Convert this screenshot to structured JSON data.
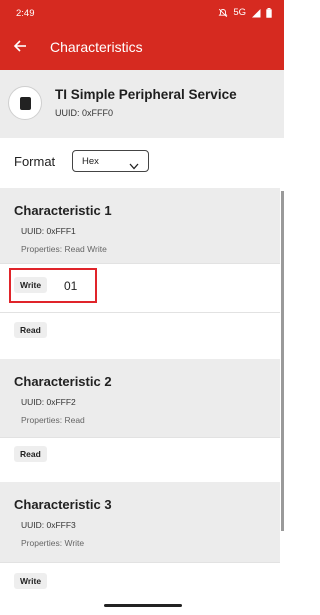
{
  "status_bar": {
    "time": "2:49",
    "network": "5G",
    "icons": [
      "bell-off-icon",
      "signal-icon",
      "battery-icon"
    ]
  },
  "app_bar": {
    "title": "Characteristics",
    "back_icon": "arrow-back-icon"
  },
  "service": {
    "name": "TI Simple Peripheral Service",
    "uuid": "UUID: 0xFFF0",
    "icon": "chip-icon"
  },
  "format": {
    "label": "Format",
    "selected": "Hex"
  },
  "characteristics": [
    {
      "name": "Characteristic 1",
      "uuid": "UUID: 0xFFF1",
      "properties": "Properties: Read Write",
      "write_label": "Write",
      "write_value": "01",
      "read_label": "Read"
    },
    {
      "name": "Characteristic 2",
      "uuid": "UUID: 0xFFF2",
      "properties": "Properties: Read",
      "read_label": "Read"
    },
    {
      "name": "Characteristic 3",
      "uuid": "UUID: 0xFFF3",
      "properties": "Properties: Write",
      "write_label": "Write"
    }
  ],
  "colors": {
    "accent": "#d62a20",
    "highlight": "#e0242a",
    "section_bg": "#ececec"
  }
}
